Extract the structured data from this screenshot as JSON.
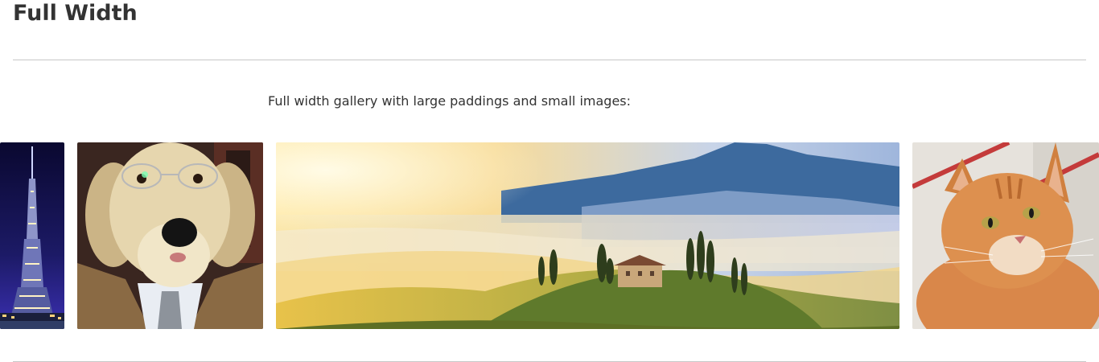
{
  "section": {
    "title": "Full Width",
    "description": "Full width gallery with large paddings and small images:"
  },
  "gallery": {
    "images": [
      {
        "subject": "tower-at-night"
      },
      {
        "subject": "dog-in-suit-with-glasses"
      },
      {
        "subject": "misty-hill-landscape-with-farmhouse"
      },
      {
        "subject": "orange-tabby-cat"
      }
    ]
  },
  "colors": {
    "text": "#333333",
    "divider": "#c8c8c8",
    "background": "#ffffff"
  }
}
